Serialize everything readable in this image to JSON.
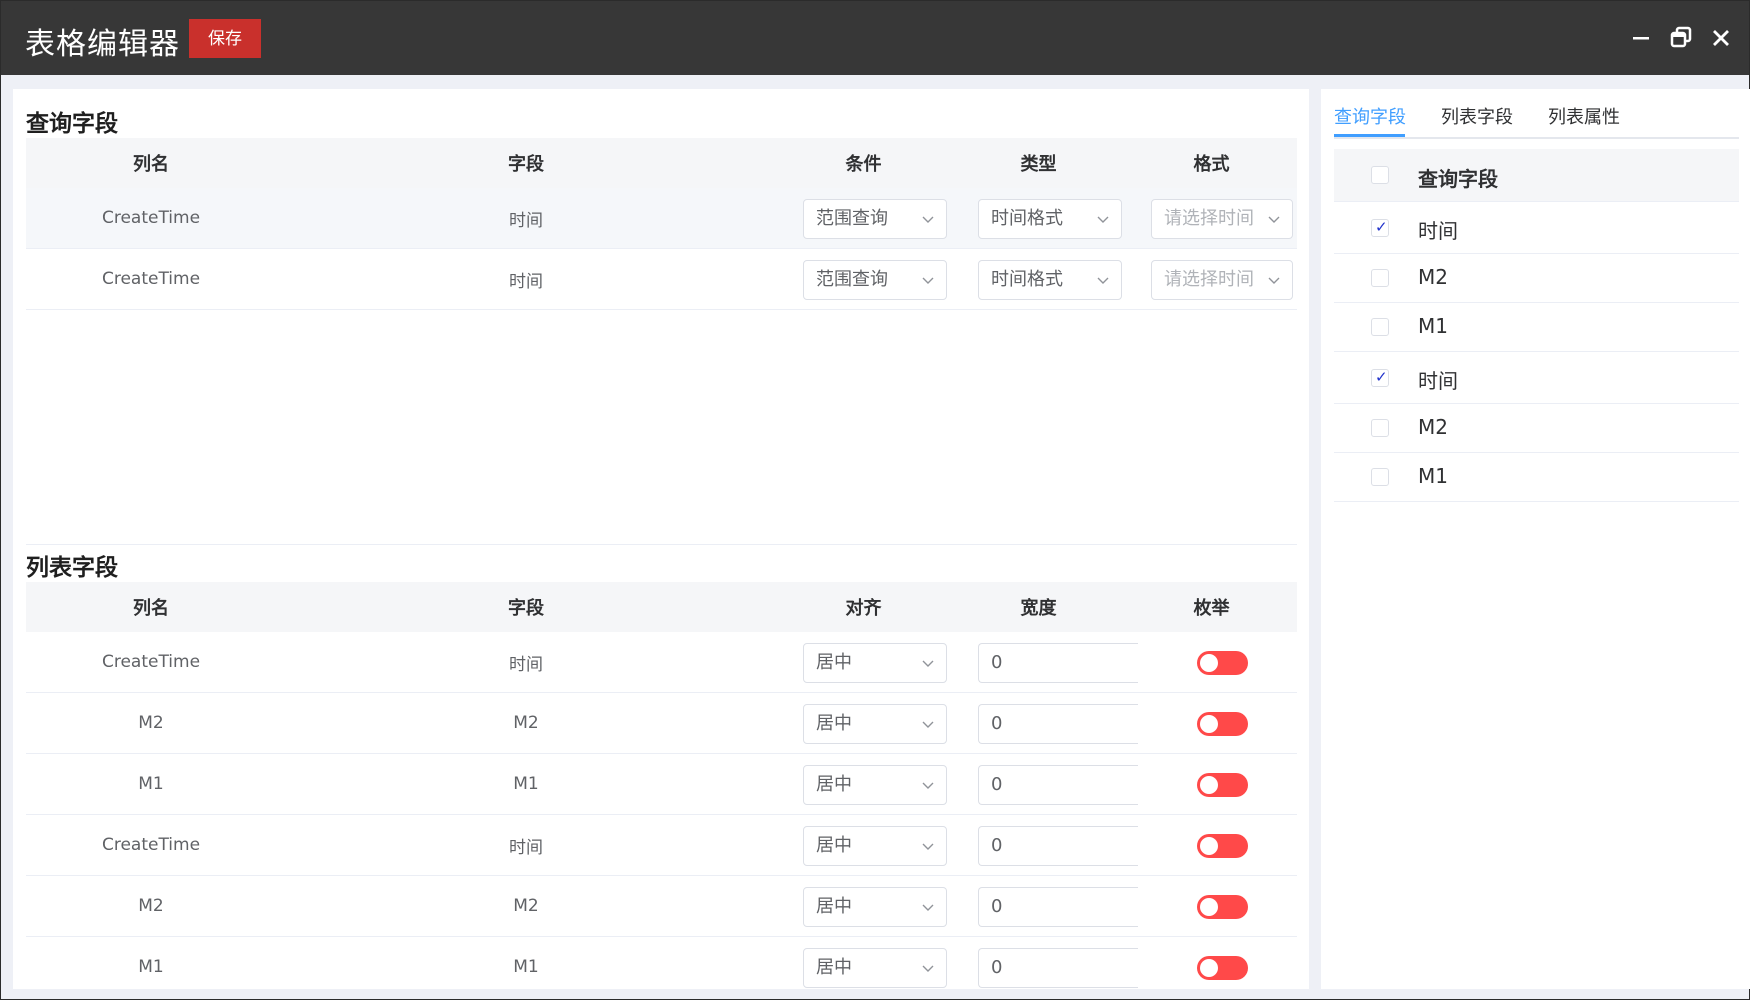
{
  "app": {
    "title": "表格编辑器",
    "save_label": "保存"
  },
  "query_section": {
    "title": "查询字段",
    "headers": [
      "列名",
      "字段",
      "条件",
      "类型",
      "格式"
    ],
    "rows": [
      {
        "name": "CreateTime",
        "field": "时间",
        "condition": "范围查询",
        "type": "时间格式",
        "format_placeholder": "请选择时间"
      },
      {
        "name": "CreateTime",
        "field": "时间",
        "condition": "范围查询",
        "type": "时间格式",
        "format_placeholder": "请选择时间"
      }
    ]
  },
  "list_section": {
    "title": "列表字段",
    "headers": [
      "列名",
      "字段",
      "对齐",
      "宽度",
      "枚举"
    ],
    "rows": [
      {
        "name": "CreateTime",
        "field": "时间",
        "align": "居中",
        "width": "0",
        "enum_on": false
      },
      {
        "name": "M2",
        "field": "M2",
        "align": "居中",
        "width": "0",
        "enum_on": false
      },
      {
        "name": "M1",
        "field": "M1",
        "align": "居中",
        "width": "0",
        "enum_on": false
      },
      {
        "name": "CreateTime",
        "field": "时间",
        "align": "居中",
        "width": "0",
        "enum_on": false
      },
      {
        "name": "M2",
        "field": "M2",
        "align": "居中",
        "width": "0",
        "enum_on": false
      },
      {
        "name": "M1",
        "field": "M1",
        "align": "居中",
        "width": "0",
        "enum_on": false
      }
    ]
  },
  "side_panel": {
    "tabs": [
      "查询字段",
      "列表字段",
      "列表属性"
    ],
    "active_tab": 0,
    "header_label": "查询字段",
    "items": [
      {
        "label": "时间",
        "checked": true
      },
      {
        "label": "M2",
        "checked": false
      },
      {
        "label": "M1",
        "checked": false
      },
      {
        "label": "时间",
        "checked": true
      },
      {
        "label": "M2",
        "checked": false
      },
      {
        "label": "M1",
        "checked": false
      }
    ]
  },
  "colors": {
    "titlebar": "#373737",
    "save": "#c9302c",
    "accent": "#409eff",
    "switch_off": "#ff4949"
  },
  "icons": [
    "minimize-icon",
    "restore-icon",
    "close-icon",
    "chevron-down-icon",
    "check-icon"
  ]
}
